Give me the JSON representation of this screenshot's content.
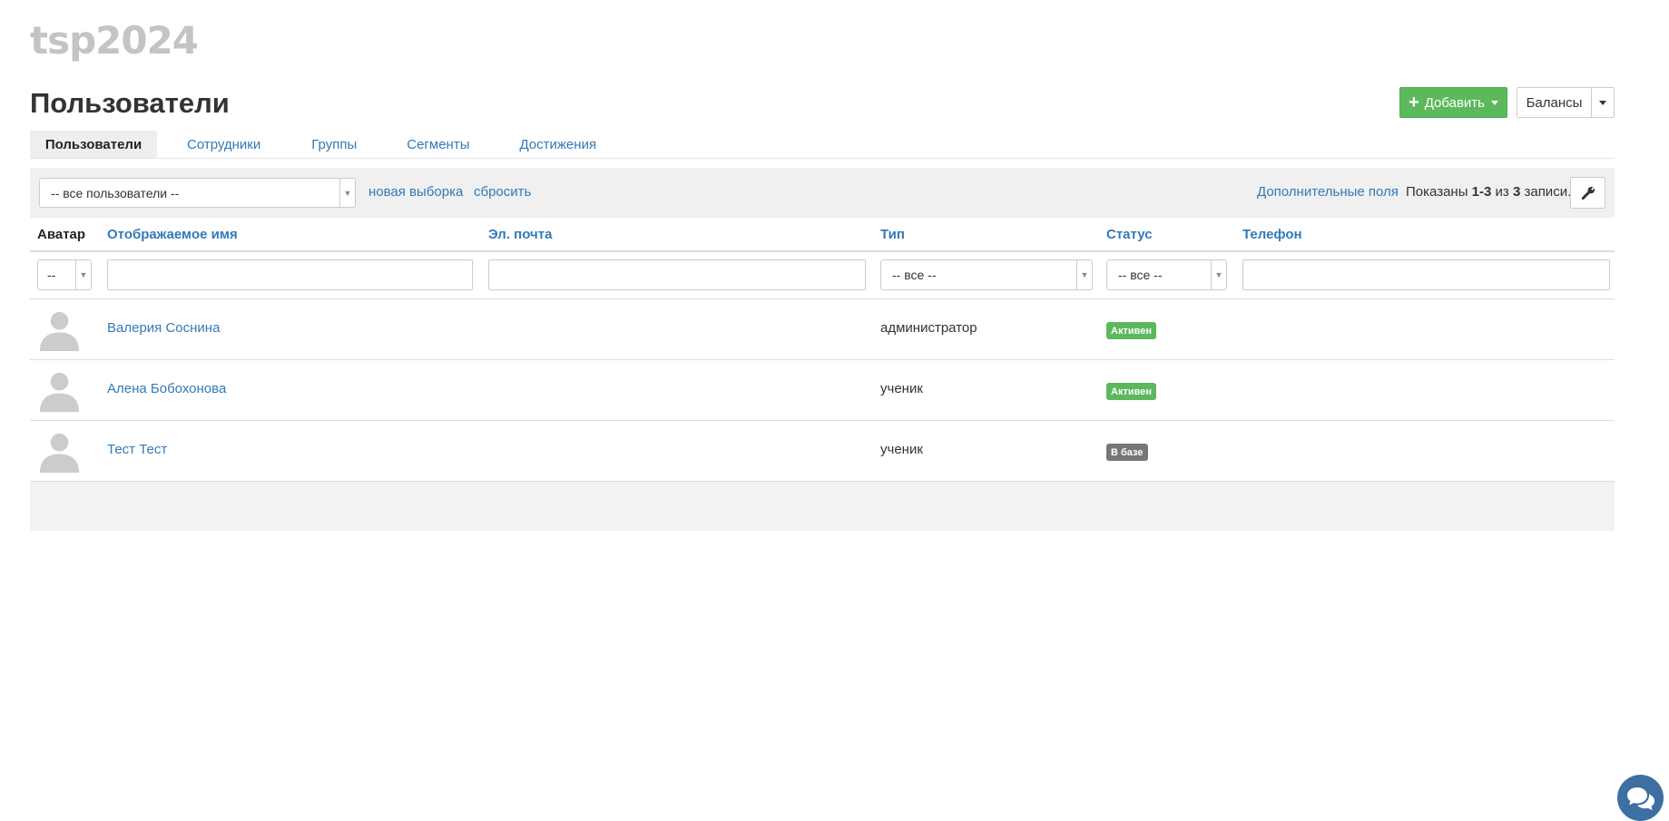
{
  "app": {
    "logo_text": "tsp2024"
  },
  "page": {
    "title": "Пользователи"
  },
  "toolbar": {
    "add_label": "Добавить",
    "balances_label": "Балансы"
  },
  "tabs": [
    {
      "label": "Пользователи",
      "active": true
    },
    {
      "label": "Сотрудники",
      "active": false
    },
    {
      "label": "Группы",
      "active": false
    },
    {
      "label": "Сегменты",
      "active": false
    },
    {
      "label": "Достижения",
      "active": false
    }
  ],
  "filter_bar": {
    "selection_value": "-- все пользователи --",
    "new_selection_link": "новая выборка",
    "reset_link": "сбросить",
    "extra_fields_link": "Дополнительные поля",
    "count_prefix": "Показаны",
    "count_range": "1-3",
    "count_middle": "из",
    "count_total": "3",
    "count_suffix": "записи."
  },
  "table": {
    "columns": [
      "Аватар",
      "Отображаемое имя",
      "Эл. почта",
      "Тип",
      "Статус",
      "Телефон"
    ],
    "filters": {
      "avatar_value": "--",
      "type_value": "-- все --",
      "status_value": "-- все --"
    },
    "rows": [
      {
        "name": "Валерия Соснина",
        "type": "администратор",
        "status": "Активен"
      },
      {
        "name": "Алена Бобохонова",
        "type": "ученик",
        "status": "Активен"
      },
      {
        "name": "Тест Тест",
        "type": "ученик",
        "status": "В базе"
      }
    ]
  },
  "colors": {
    "brand_green": "#5cb85c",
    "link_blue": "#337ab7",
    "status_active": "#5cb85c",
    "status_in_base": "#777777",
    "chat_button": "#3d6fa2"
  },
  "icons": {
    "add": "plus-icon",
    "settings": "wrench-icon",
    "avatar": "user-silhouette-icon",
    "chat": "chat-bubbles-icon"
  }
}
